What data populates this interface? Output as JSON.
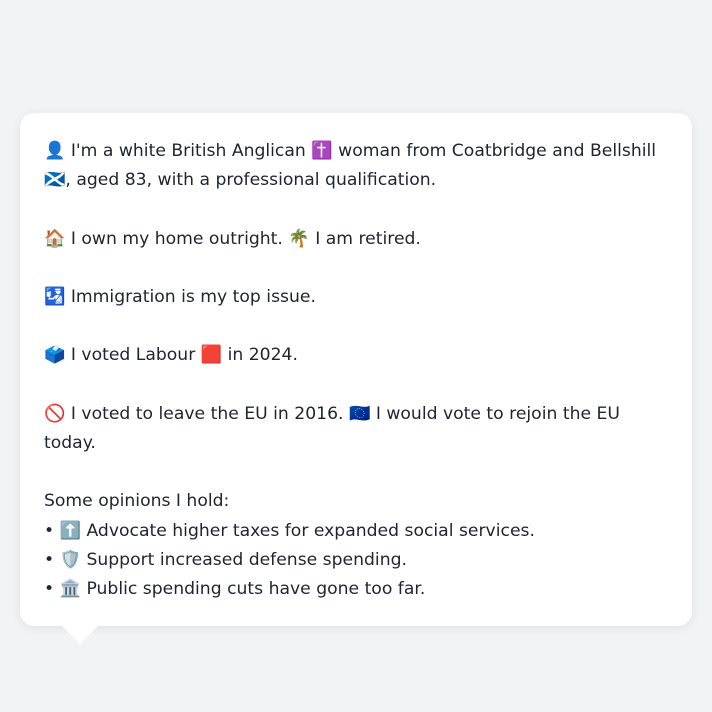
{
  "profile": {
    "identity": "👤 I'm a white British Anglican ✝️ woman from Coatbridge and Bellshill 🏴󠁧󠁢󠁳󠁣󠁴󠁿, aged 83, with a professional qualification.",
    "home_work": "🏠 I own my home outright. 🌴 I am retired.",
    "top_issue": "🛂 Immigration is my top issue.",
    "vote_2024": "🗳️ I voted Labour 🟥 in 2024.",
    "eu": "🚫 I voted to leave the EU in 2016. 🇪🇺 I would vote to rejoin the EU today.",
    "opinions_heading": "Some opinions I hold:",
    "opinions": [
      "• ⬆️ Advocate higher taxes for expanded social services.",
      "• 🛡️ Support increased defense spending.",
      "• 🏛️ Public spending cuts have gone too far."
    ]
  }
}
